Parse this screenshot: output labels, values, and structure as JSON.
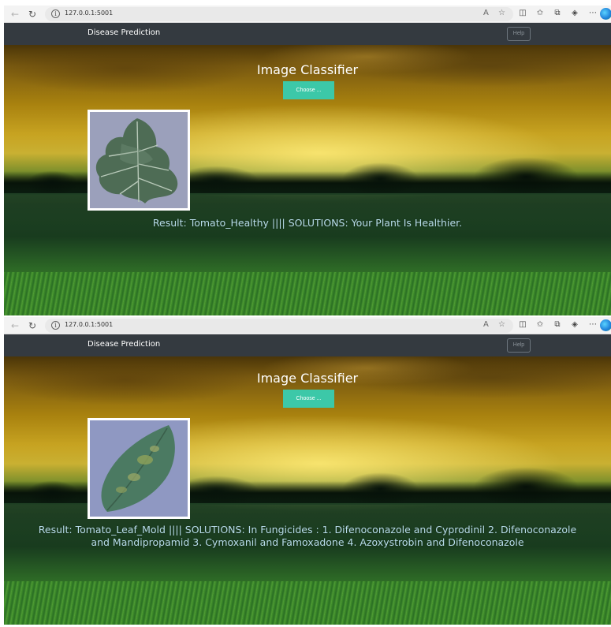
{
  "browser": {
    "url": "127.0.0.1:5001",
    "icons": [
      "back-icon",
      "reload-icon",
      "info-icon",
      "read-aloud-icon",
      "favorite-star-icon",
      "split-screen-icon",
      "favorites-icon",
      "collections-icon",
      "extensions-icon",
      "more-icon",
      "edge-copilot-icon"
    ]
  },
  "app": {
    "brand": "Disease Prediction",
    "help_label": "Help",
    "title": "Image Classifier",
    "choose_label": "Choose ..."
  },
  "screens": [
    {
      "result_text": "Result: Tomato_Healthy |||| SOLUTIONS: Your Plant Is Healthier."
    },
    {
      "result_text": "Result: Tomato_Leaf_Mold |||| SOLUTIONS: In Fungicides : 1. Difenoconazole and Cyprodinil 2. Difenoconazole and Mandipropamid 3. Cymoxanil and Famoxadone 4. Azoxystrobin and Difenoconazole"
    }
  ],
  "colors": {
    "navbar": "#343a40",
    "button": "#3cc8a8",
    "result_text": "#b8dcea"
  }
}
